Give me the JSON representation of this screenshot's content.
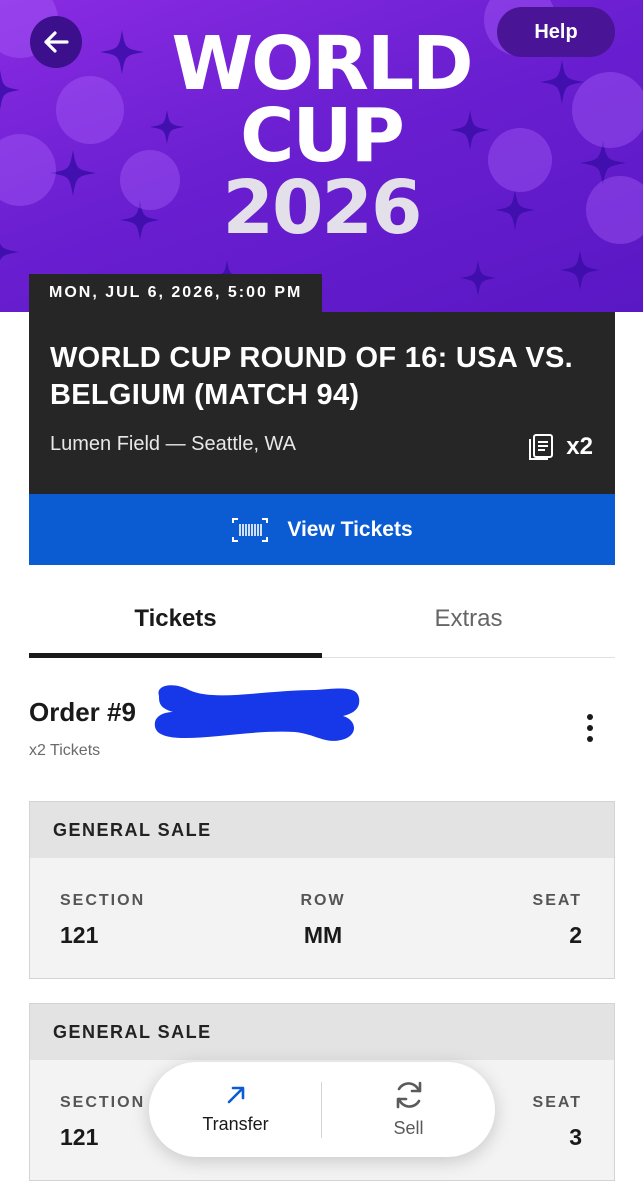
{
  "header": {
    "help_label": "Help",
    "logo": {
      "line1": "WORLD",
      "line2": "CUP",
      "line3": "2026"
    }
  },
  "event": {
    "date_time": "MON, JUL 6, 2026, 5:00 PM",
    "title": "WORLD CUP ROUND OF 16: USA VS. BELGIUM (MATCH 94)",
    "venue": "Lumen Field — Seattle, WA",
    "quantity": "x2",
    "view_tickets_label": "View Tickets"
  },
  "tabs": [
    {
      "label": "Tickets",
      "active": true
    },
    {
      "label": "Extras",
      "active": false
    }
  ],
  "order": {
    "title": "Order #9",
    "count": "x2 Tickets"
  },
  "tickets": [
    {
      "category": "GENERAL SALE",
      "section_label": "SECTION",
      "section": "121",
      "row_label": "ROW",
      "row": "MM",
      "seat_label": "SEAT",
      "seat": "2"
    },
    {
      "category": "GENERAL SALE",
      "section_label": "SECTION",
      "section": "121",
      "seat_label": "SEAT",
      "seat": "3"
    }
  ],
  "actions": {
    "transfer_label": "Transfer",
    "sell_label": "Sell"
  },
  "colors": {
    "hero_purple": "#6a1fd1",
    "dark_card": "#262626",
    "accent_blue": "#0b5bd3",
    "redaction_blue": "#1638e8"
  },
  "icons": [
    "back-arrow-icon",
    "ticket-stack-icon",
    "barcode-icon",
    "transfer-arrow-icon",
    "sell-refresh-icon",
    "more-vertical-icon"
  ]
}
